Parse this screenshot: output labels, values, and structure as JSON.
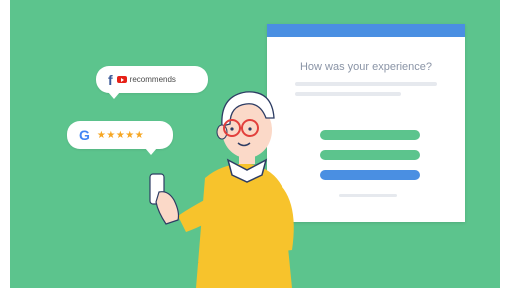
{
  "card": {
    "title": "How was your experience?"
  },
  "facebook_bubble": {
    "facebook_glyph": "f",
    "text": "recommends"
  },
  "google_bubble": {
    "google_glyph": "G",
    "stars": "★★★★★"
  },
  "colors": {
    "background": "#5cc48d",
    "card_header": "#4a8fe2",
    "green_option": "#5cc48d",
    "blue_option": "#4a8fe2",
    "star": "#f6a623",
    "sweater": "#f7c32c",
    "facebook": "#3b5998",
    "youtube": "#e62117"
  },
  "icons": {
    "facebook": "facebook-icon",
    "youtube": "youtube-icon",
    "google": "google-icon",
    "star": "star-icon"
  }
}
